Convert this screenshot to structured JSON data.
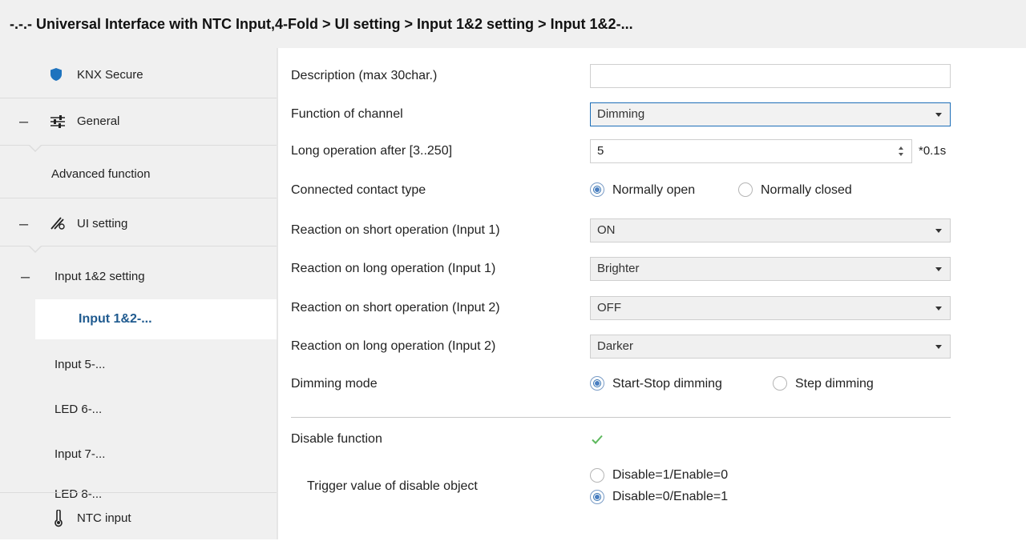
{
  "breadcrumb": "-.-.- Universal Interface with NTC Input,4-Fold > UI setting > Input 1&2 setting > Input 1&2-...",
  "sidebar": {
    "items": [
      {
        "label": "KNX Secure",
        "icon": "shield-icon"
      },
      {
        "label": "General",
        "icon": "sliders-icon",
        "expand": "–"
      },
      {
        "label": "Advanced function"
      },
      {
        "label": "UI setting",
        "icon": "ui-tools-icon",
        "expand": "–"
      },
      {
        "label": "Input 1&2 setting",
        "expand": "–"
      },
      {
        "label": "Input 1&2-...",
        "active": true
      },
      {
        "label": "Input 5-..."
      },
      {
        "label": "LED 6-..."
      },
      {
        "label": "Input 7-..."
      },
      {
        "label": "LED 8-..."
      },
      {
        "label": "NTC input",
        "icon": "thermometer-icon"
      }
    ]
  },
  "form": {
    "description": {
      "label": "Description (max 30char.)",
      "value": ""
    },
    "function_of_channel": {
      "label": "Function of channel",
      "value": "Dimming"
    },
    "long_operation": {
      "label": "Long operation after [3..250]",
      "value": "5",
      "unit": "*0.1s"
    },
    "contact_type": {
      "label": "Connected contact type",
      "options": [
        "Normally open",
        "Normally closed"
      ],
      "selected": "Normally open"
    },
    "short_input1": {
      "label": "Reaction on short operation (Input 1)",
      "value": "ON"
    },
    "long_input1": {
      "label": "Reaction on long operation (Input 1)",
      "value": "Brighter"
    },
    "short_input2": {
      "label": "Reaction on short operation (Input 2)",
      "value": "OFF"
    },
    "long_input2": {
      "label": "Reaction on long operation (Input 2)",
      "value": "Darker"
    },
    "dimming_mode": {
      "label": "Dimming mode",
      "options": [
        "Start-Stop dimming",
        "Step dimming"
      ],
      "selected": "Start-Stop dimming"
    },
    "disable_function": {
      "label": "Disable function",
      "checked": true
    },
    "trigger_value": {
      "label": "Trigger value of disable object",
      "options": [
        "Disable=1/Enable=0",
        "Disable=0/Enable=1"
      ],
      "selected": "Disable=0/Enable=1"
    }
  },
  "colors": {
    "accent": "#1f5a8f",
    "check": "#5cb85c",
    "focus_border": "#1e6fb8"
  }
}
